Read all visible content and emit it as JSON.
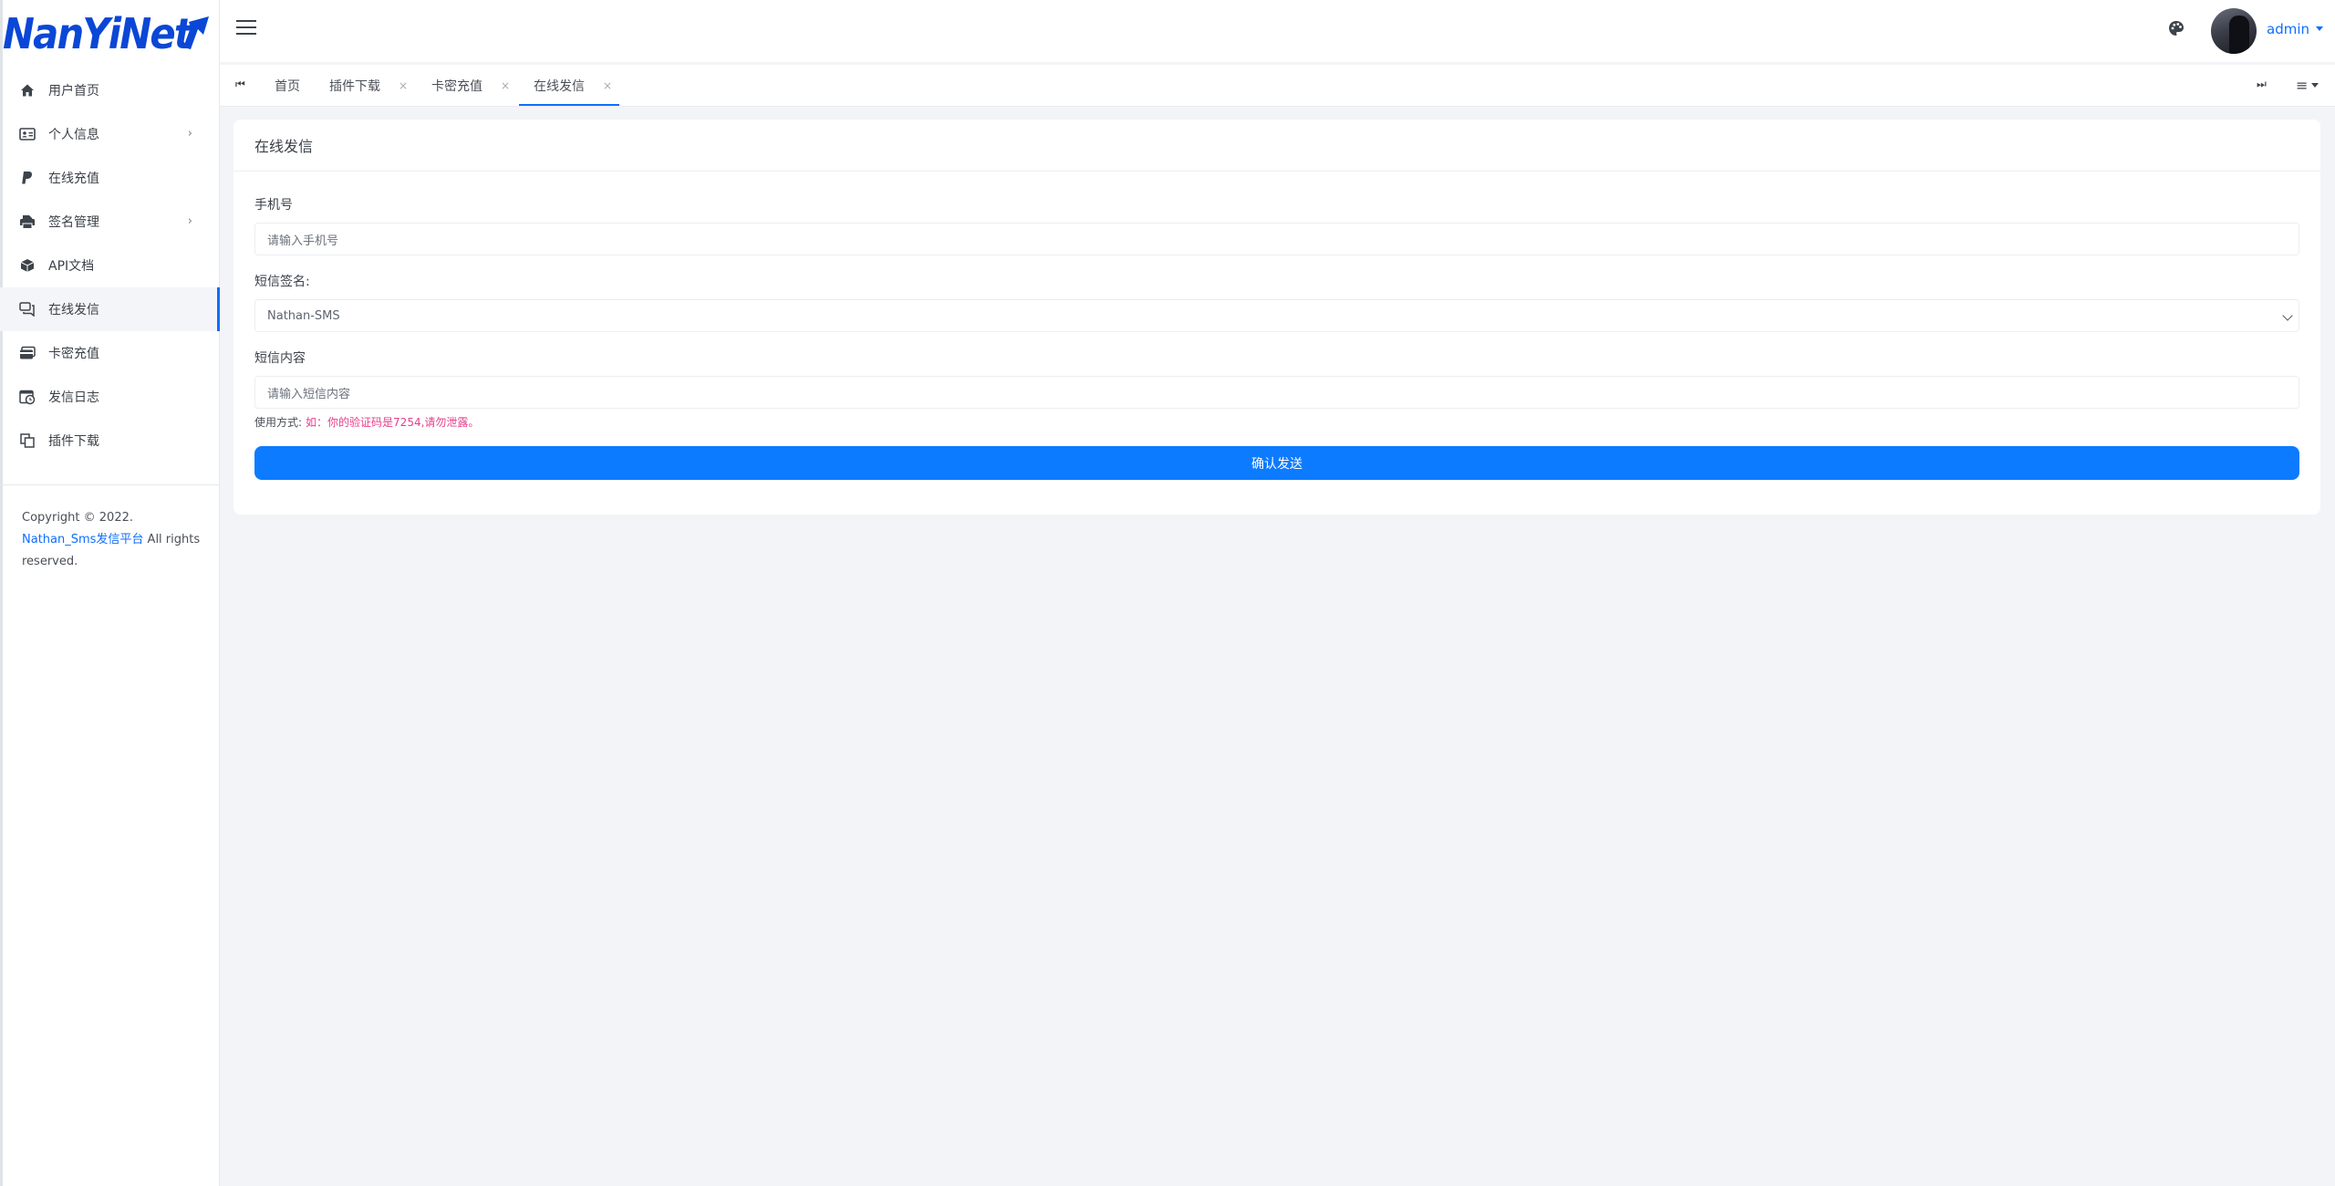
{
  "brand": {
    "logo_text": "NanYiNet",
    "logo_color": "#0b47d6"
  },
  "sidebar": {
    "items": [
      {
        "label": "用户首页",
        "icon": "home-icon",
        "has_children": false,
        "active": false
      },
      {
        "label": "个人信息",
        "icon": "id-card-icon",
        "has_children": true,
        "active": false
      },
      {
        "label": "在线充值",
        "icon": "paypal-icon",
        "has_children": false,
        "active": false
      },
      {
        "label": "签名管理",
        "icon": "printer-icon",
        "has_children": true,
        "active": false
      },
      {
        "label": "API文档",
        "icon": "cube-icon",
        "has_children": false,
        "active": false
      },
      {
        "label": "在线发信",
        "icon": "chat-icon",
        "has_children": false,
        "active": true
      },
      {
        "label": "卡密充值",
        "icon": "card-icon",
        "has_children": false,
        "active": false
      },
      {
        "label": "发信日志",
        "icon": "calendar-clock-icon",
        "has_children": false,
        "active": false
      },
      {
        "label": "插件下载",
        "icon": "copy-icon",
        "has_children": false,
        "active": false
      }
    ],
    "copyright": {
      "prefix": "Copyright © 2022.",
      "link_text": "Nathan_Sms发信平台",
      "suffix": " All rights reserved."
    }
  },
  "topbar": {
    "user_name": "admin"
  },
  "tabs": {
    "items": [
      {
        "label": "首页",
        "closable": false,
        "active": false
      },
      {
        "label": "插件下载",
        "closable": true,
        "active": false
      },
      {
        "label": "卡密充值",
        "closable": true,
        "active": false
      },
      {
        "label": "在线发信",
        "closable": true,
        "active": true
      }
    ],
    "close_glyph": "×",
    "prev_glyph": "⏮",
    "next_glyph": "⏭",
    "menu_glyph": "≡"
  },
  "card": {
    "title": "在线发信",
    "phone_label": "手机号",
    "phone_placeholder": "请输入手机号",
    "signature_label": "短信签名:",
    "signature_value": "Nathan-SMS",
    "content_label": "短信内容",
    "content_placeholder": "请输入短信内容",
    "hint_prefix": "使用方式:",
    "hint_example": "如：你的验证码是7254,请勿泄露。",
    "submit_label": "确认发送"
  },
  "colors": {
    "primary": "#0d7bff",
    "hint_pink": "#e83e8c",
    "background": "#f3f4f8"
  }
}
